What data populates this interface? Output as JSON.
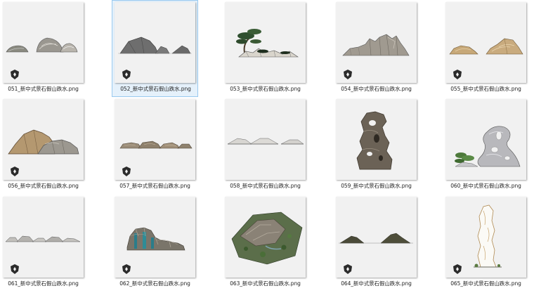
{
  "files": [
    {
      "name": "051_新中式景石假山跌水.png",
      "icon": "rock-stones-thumbnail",
      "selected": false
    },
    {
      "name": "052_新中式景石假山跌水.png",
      "icon": "gray-rocks-thumbnail",
      "selected": true
    },
    {
      "name": "053_新中式景石假山跌水.png",
      "icon": "pine-rock-thumbnail",
      "selected": false
    },
    {
      "name": "054_新中式景石假山跌水.png",
      "icon": "rock-range-thumbnail",
      "selected": false
    },
    {
      "name": "055_新中式景石假山跌水.png",
      "icon": "sandstone-rocks-thumbnail",
      "selected": false
    },
    {
      "name": "056_新中式景石假山跌水.png",
      "icon": "brown-rocks-thumbnail",
      "selected": false
    },
    {
      "name": "057_新中式景石假山跌水.png",
      "icon": "flat-stones-thumbnail",
      "selected": false
    },
    {
      "name": "058_新中式景石假山跌水.png",
      "icon": "flat-slabs-thumbnail",
      "selected": false
    },
    {
      "name": "059_新中式景石假山跌水.png",
      "icon": "taihu-stone-thumbnail",
      "selected": false
    },
    {
      "name": "060_新中式景石假山跌水.png",
      "icon": "scholar-rock-plant-thumbnail",
      "selected": false
    },
    {
      "name": "061_新中式景石假山跌水.png",
      "icon": "low-stones-thumbnail",
      "selected": false
    },
    {
      "name": "062_新中式景石假山跌水.png",
      "icon": "rockery-waterfall-thumbnail",
      "selected": false
    },
    {
      "name": "063_新中式景石假山跌水.png",
      "icon": "rockery-island-thumbnail",
      "selected": false
    },
    {
      "name": "064_新中式景石假山跌水.png",
      "icon": "dark-hills-thumbnail",
      "selected": false
    },
    {
      "name": "065_新中式景石假山跌水.png",
      "icon": "tall-rock-line-thumbnail",
      "selected": false
    }
  ]
}
